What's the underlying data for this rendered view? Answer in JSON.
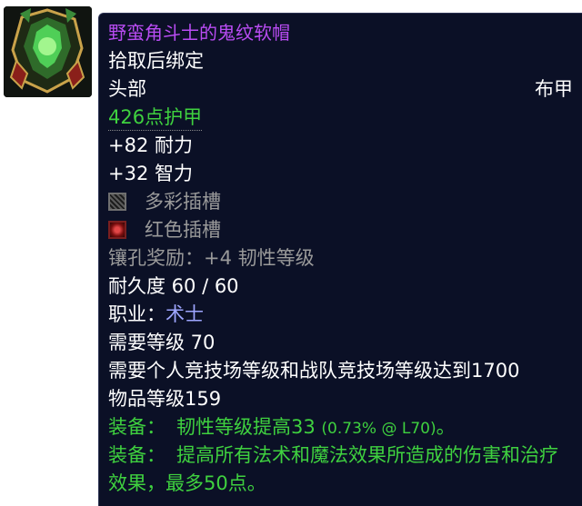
{
  "item": {
    "name": "野蛮角斗士的鬼纹软帽",
    "bind": "拾取后绑定",
    "slot": "头部",
    "armor_type": "布甲",
    "armor": "426点护甲",
    "stats": [
      "+82 耐力",
      "+32 智力"
    ],
    "sockets": [
      {
        "type": "prismatic",
        "label": "多彩插槽"
      },
      {
        "type": "red",
        "label": "红色插槽"
      }
    ],
    "socket_bonus": "镶孔奖励：+4 韧性等级",
    "durability": "耐久度 60 / 60",
    "class_label": "职业：",
    "class_value": "术士",
    "req_level": "需要等级 70",
    "req_arena": "需要个人竞技场等级和战队竞技场等级达到1700",
    "item_level": "物品等级159",
    "equip": [
      {
        "label": "装备：",
        "text": "韧性等级提高33",
        "detail": "(0.73% @ L70)",
        "end": "。"
      },
      {
        "label": "装备：",
        "text": "提高所有法术和魔法效果所造成的伤害和治疗效果，最多50点。"
      }
    ]
  },
  "colors": {
    "epic": "#b94cf3",
    "uncommon": "#3fd13f",
    "class": "#9ea6ff",
    "muted": "#9a9a9a",
    "background": "#0b1026"
  },
  "icon": "helmet-icon"
}
